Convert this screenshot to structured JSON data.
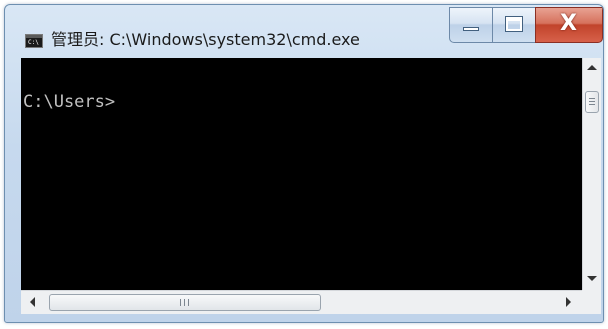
{
  "window": {
    "title": "管理员: C:\\Windows\\system32\\cmd.exe",
    "app_icon": "command-prompt-icon",
    "app_icon_text": "C:\\"
  },
  "caption_buttons": {
    "minimize_icon": "minimize-icon",
    "maximize_icon": "maximize-icon",
    "close_icon": "close-icon",
    "close_glyph": "X"
  },
  "console": {
    "prompt": "C:\\Users>"
  },
  "scrollbars": {
    "vertical_up_icon": "arrow-up-icon",
    "vertical_down_icon": "arrow-down-icon",
    "horizontal_left_icon": "arrow-left-icon",
    "horizontal_right_icon": "arrow-right-icon"
  },
  "colors": {
    "console_background": "#000000",
    "console_text": "#c0c0c0",
    "close_button": "#c1432b",
    "titlebar": "#c6d9ee"
  }
}
